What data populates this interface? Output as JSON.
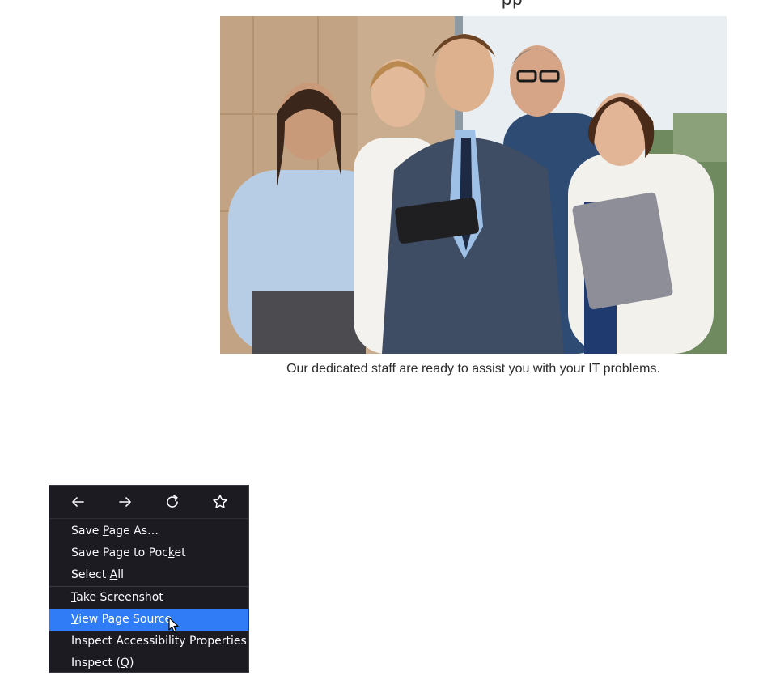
{
  "page": {
    "heading_fragment": "pp",
    "photo_description_icon": "team-photo",
    "caption": "Our dedicated staff are ready to assist you with your IT problems."
  },
  "context_menu": {
    "nav": {
      "back_icon": "back-arrow-icon",
      "forward_icon": "forward-arrow-icon",
      "reload_icon": "reload-icon",
      "bookmark_icon": "star-icon"
    },
    "items": [
      {
        "label": "Save Page As…",
        "access_key": "P"
      },
      {
        "label": "Save Page to Pocket",
        "access_key": "k"
      },
      {
        "label": "Select All",
        "access_key": "A"
      },
      {
        "label": "Take Screenshot",
        "access_key": "T"
      },
      {
        "label": "View Page Source",
        "access_key": "V",
        "highlighted": true
      },
      {
        "label": "Inspect Accessibility Properties",
        "access_key": ""
      },
      {
        "label": "Inspect (Q)",
        "access_key": "Q"
      }
    ],
    "colors": {
      "background": "#1c1b22",
      "highlight": "#2f7cf6",
      "text": "#fbfbfe"
    }
  }
}
